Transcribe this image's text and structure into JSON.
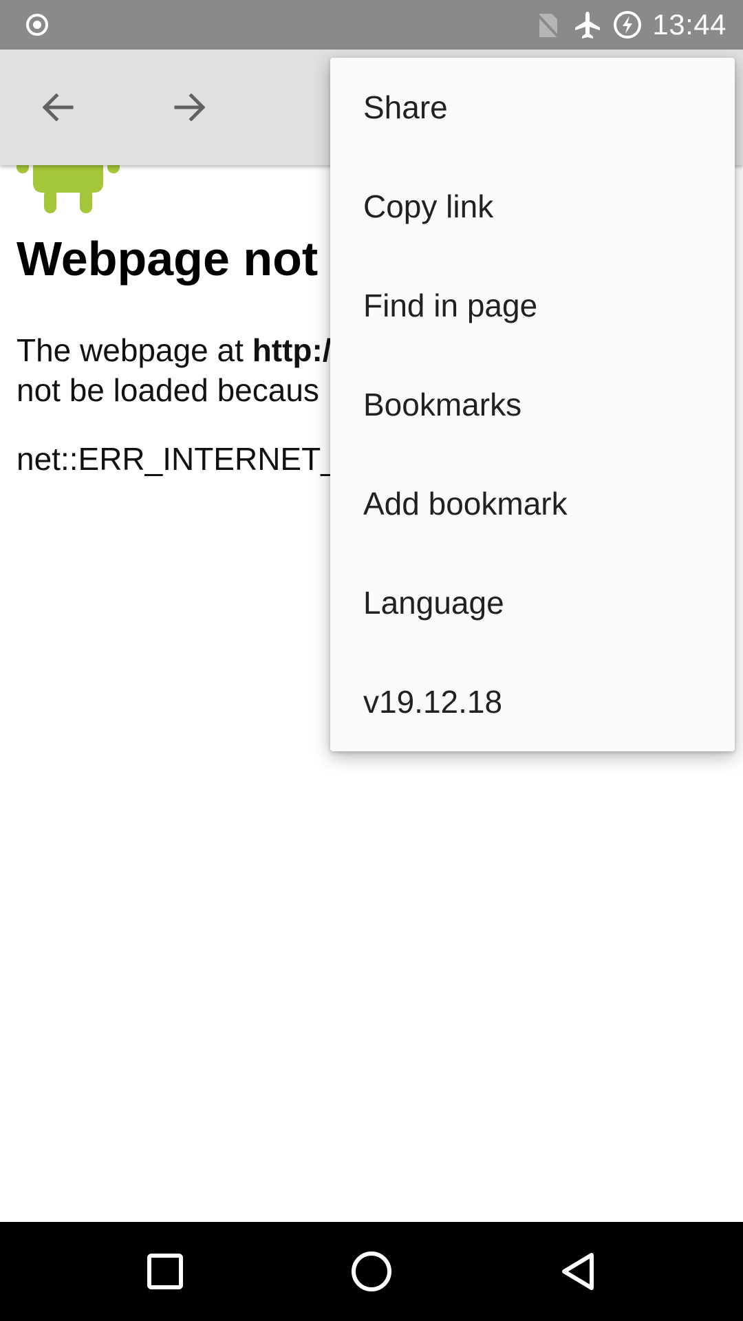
{
  "status_bar": {
    "time": "13:44",
    "icons": [
      "record-icon",
      "no-sim-icon",
      "airplane-mode-icon",
      "battery-charging-icon"
    ]
  },
  "toolbar": {
    "back_icon": "arrow-left-icon",
    "forward_icon": "arrow-right-icon"
  },
  "page": {
    "title": "Webpage not a",
    "body_prefix": "The webpage at ",
    "body_bold": "http:/",
    "body_line2": "not be loaded becaus",
    "error_code": "net::ERR_INTERNET_D"
  },
  "menu": {
    "items": [
      {
        "label": "Share"
      },
      {
        "label": "Copy link"
      },
      {
        "label": "Find in page"
      },
      {
        "label": "Bookmarks"
      },
      {
        "label": "Add bookmark"
      },
      {
        "label": "Language"
      },
      {
        "label": "v19.12.18"
      }
    ]
  },
  "nav_bar": {
    "icons": [
      "recents-icon",
      "home-icon",
      "back-icon"
    ]
  },
  "colors": {
    "status_bar": "#8a8a8a",
    "toolbar": "#e0e0e0",
    "menu_bg": "#fafafa",
    "android_green": "#a4c639",
    "nav_bar": "#000000"
  }
}
